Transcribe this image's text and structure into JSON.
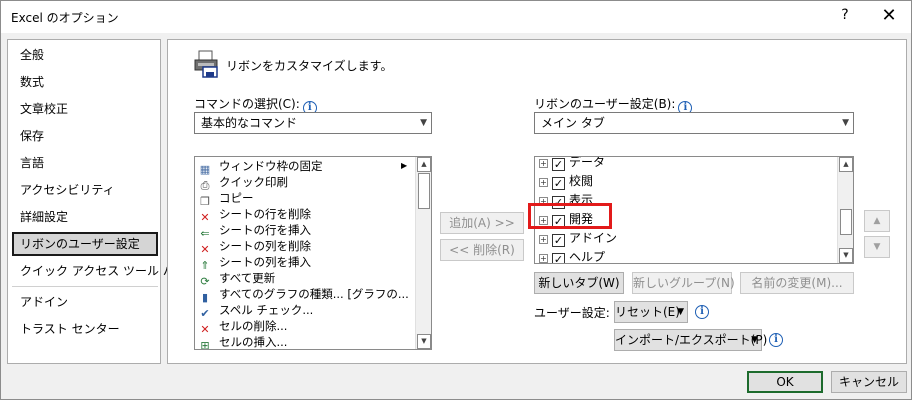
{
  "window": {
    "title": "Excel のオプション",
    "help_glyph": "?",
    "close_glyph": "✕"
  },
  "nav": {
    "items": [
      {
        "label": "全般"
      },
      {
        "label": "数式"
      },
      {
        "label": "文章校正"
      },
      {
        "label": "保存"
      },
      {
        "label": "言語"
      },
      {
        "label": "アクセシビリティ"
      },
      {
        "label": "詳細設定"
      },
      {
        "label": "リボンのユーザー設定",
        "selected": true
      },
      {
        "label": "クイック アクセス ツール バー"
      },
      {
        "label": "アドイン"
      },
      {
        "label": "トラスト センター"
      }
    ]
  },
  "main": {
    "heading": "リボンをカスタマイズします。",
    "commands_label": "コマンドの選択(C):",
    "commands_combo_value": "基本的なコマンド",
    "ribbon_label": "リボンのユーザー設定(B):",
    "ribbon_combo_value": "メイン タブ",
    "info_glyph": "i",
    "command_list": [
      {
        "label": "ウィンドウ枠の固定",
        "icon": "freeze-panes-icon",
        "glyph": "▦",
        "color": "#4a6fa5",
        "has_submenu": true
      },
      {
        "label": "クイック印刷",
        "icon": "quick-print-icon",
        "glyph": "⎙",
        "color": "#444444"
      },
      {
        "label": "コピー",
        "icon": "copy-icon",
        "glyph": "❐",
        "color": "#555555"
      },
      {
        "label": "シートの行を削除",
        "icon": "delete-row-icon",
        "glyph": "✕",
        "color": "#d02020"
      },
      {
        "label": "シートの行を挿入",
        "icon": "insert-row-icon",
        "glyph": "⇐",
        "color": "#2a7a3c"
      },
      {
        "label": "シートの列を削除",
        "icon": "delete-column-icon",
        "glyph": "✕",
        "color": "#d02020"
      },
      {
        "label": "シートの列を挿入",
        "icon": "insert-column-icon",
        "glyph": "⇑",
        "color": "#2a7a3c"
      },
      {
        "label": "すべて更新",
        "icon": "refresh-all-icon",
        "glyph": "⟳",
        "color": "#2a7a3c"
      },
      {
        "label": "すべてのグラフの種類... [グラフの...",
        "icon": "chart-types-icon",
        "glyph": "▮",
        "color": "#3060a0"
      },
      {
        "label": "スペル チェック...",
        "icon": "spell-check-icon",
        "glyph": "✔",
        "color": "#3060a0"
      },
      {
        "label": "セルの削除...",
        "icon": "delete-cells-icon",
        "glyph": "✕",
        "color": "#d02020"
      },
      {
        "label": "セルの挿入...",
        "icon": "insert-cells-icon",
        "glyph": "⊞",
        "color": "#2a7a3c"
      }
    ],
    "tree": [
      {
        "label": "データ",
        "checked": true
      },
      {
        "label": "校閲",
        "checked": true
      },
      {
        "label": "表示",
        "checked": true
      },
      {
        "label": "開発",
        "checked": true,
        "highlighted": true
      },
      {
        "label": "アドイン",
        "checked": true
      },
      {
        "label": "ヘルプ",
        "checked": true
      }
    ],
    "expand_glyph": "+",
    "check_glyph": "✓",
    "add_button": "追加(A) >>",
    "remove_button": "<< 削除(R)",
    "new_tab_button": "新しいタブ(W)",
    "new_group_button": "新しいグループ(N)",
    "rename_button": "名前の変更(M)...",
    "user_settings_label": "ユーザー設定:",
    "reset_button": "リセット(E)",
    "import_export_button": "インポート/エクスポート(P)",
    "move_up_glyph": "▲",
    "move_down_glyph": "▼",
    "dropdown_glyph": "▼"
  },
  "footer": {
    "ok": "OK",
    "cancel": "キャンセル"
  },
  "colors": {
    "highlight": "#e21a1a",
    "info": "#1e5fb4",
    "ok_border": "#1d6b2d"
  }
}
